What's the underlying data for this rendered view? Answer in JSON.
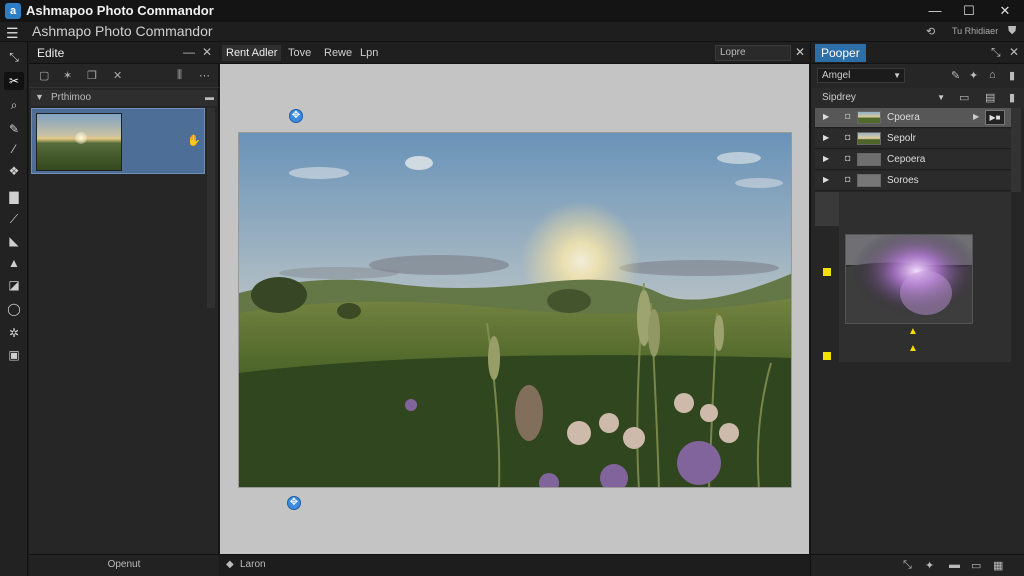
{
  "window": {
    "title": "Ashmapoo Photo Commandor",
    "subtitle": "Ashmapo Photo Commandor",
    "logo_letter": "a",
    "tray_text": "Tu Rhidiaer",
    "controls": [
      "—",
      "☐",
      "✕"
    ]
  },
  "menubar": {
    "menu_icon": "☰"
  },
  "left_tools": [
    {
      "icon": "crop-icon",
      "glyph": "✂",
      "active": true
    },
    {
      "icon": "zoom-icon",
      "glyph": "⌕"
    },
    {
      "icon": "brush-icon",
      "glyph": "✎"
    },
    {
      "icon": "dropper-icon",
      "glyph": "⁄"
    },
    {
      "icon": "clone-icon",
      "glyph": "❖"
    },
    {
      "icon": "note-icon",
      "glyph": "▇"
    },
    {
      "icon": "line-icon",
      "glyph": "⟋"
    },
    {
      "icon": "fill-icon",
      "glyph": "◣"
    },
    {
      "icon": "shape-icon",
      "glyph": "▲"
    },
    {
      "icon": "layer-icon",
      "glyph": "◪"
    },
    {
      "icon": "lasso-icon",
      "glyph": "◯"
    },
    {
      "icon": "effects-icon",
      "glyph": "✲"
    },
    {
      "icon": "text-icon",
      "glyph": "▣"
    }
  ],
  "edit_panel": {
    "tab_label": "Edite",
    "section_label": "Prthimoo",
    "footer_label": "Openut"
  },
  "center": {
    "tabs": [
      "Rent Adler",
      "Tove",
      "Rewe",
      "Lpn"
    ],
    "search_text": "Lopre",
    "status_label": "Laron"
  },
  "right_panel": {
    "tab_label": "Pooper",
    "dropdown1": "Amgel",
    "dropdown2": "Sipdrey",
    "layers": [
      {
        "name": "Cpoera",
        "selected": true
      },
      {
        "name": "Sepolr",
        "selected": false
      },
      {
        "name": "Cepoera",
        "selected": false
      },
      {
        "name": "Soroes",
        "selected": false
      }
    ]
  },
  "colors": {
    "accent": "#2c6ea8",
    "selection": "#4d6e96",
    "handle": "#3c8be0",
    "marker": "#f5e100"
  }
}
